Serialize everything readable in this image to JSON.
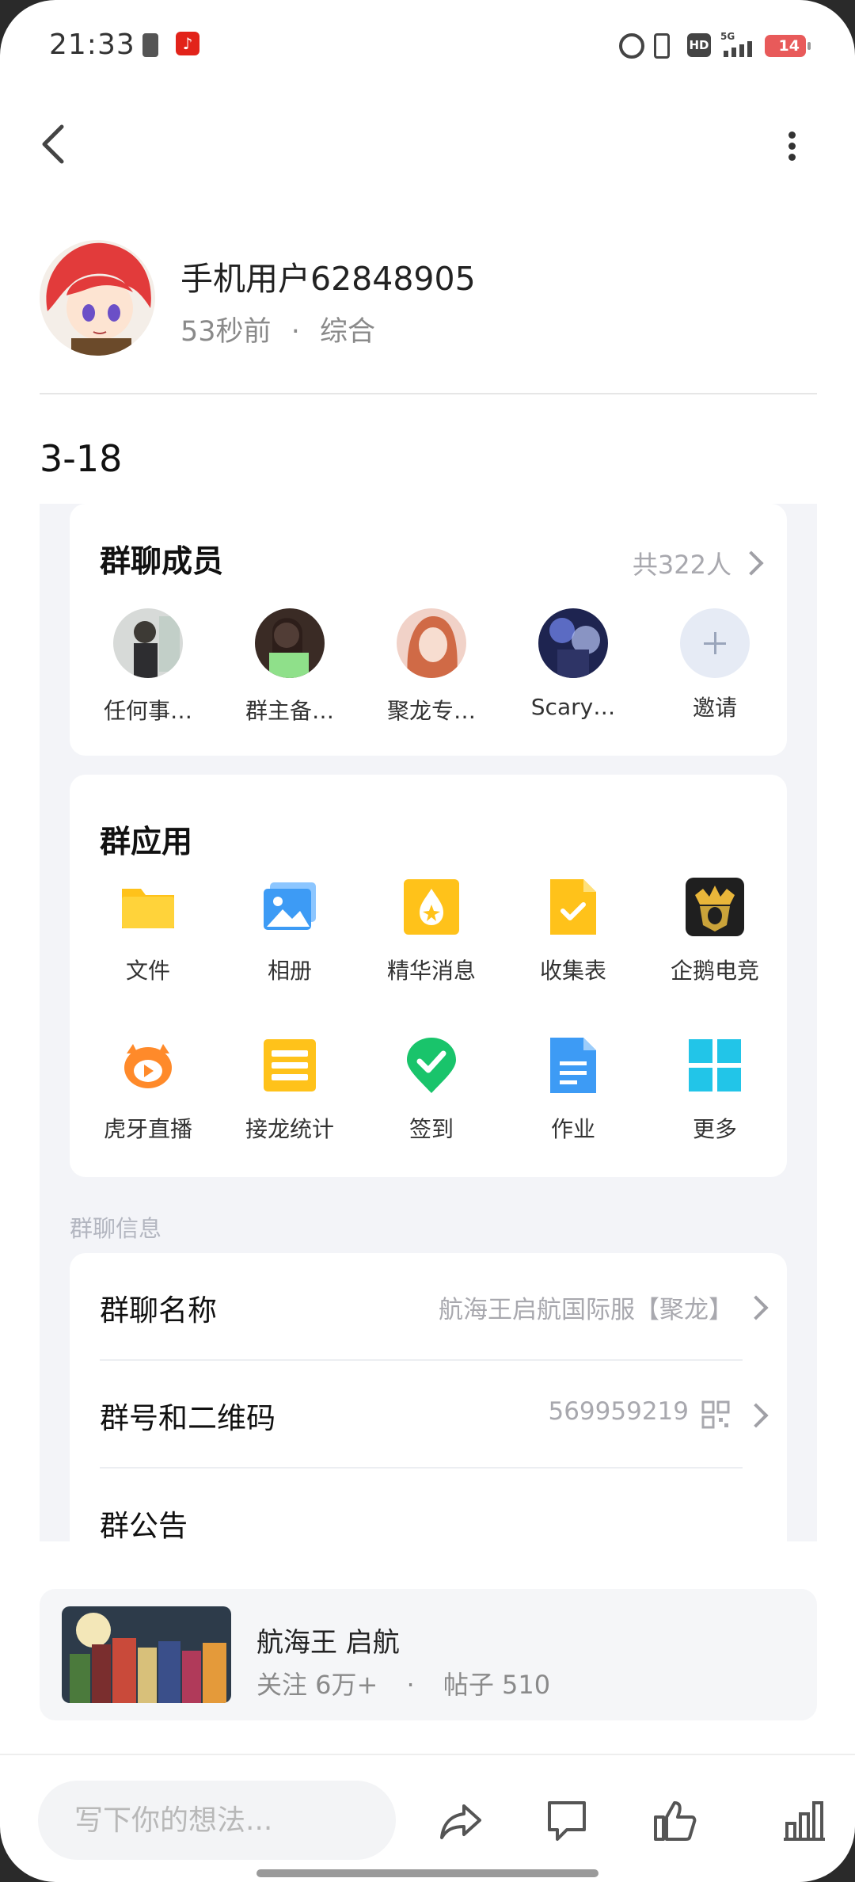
{
  "status_bar": {
    "time": "21:33",
    "battery": "14",
    "network_badge": "HD",
    "network_gen": "5G",
    "app_badge_icon": "netease-music-icon"
  },
  "nav": {
    "back_icon": "chevron-left-icon",
    "more_icon": "more-vertical-icon"
  },
  "author": {
    "name": "手机用户62848905",
    "time_ago": "53秒前",
    "separator": "·",
    "category": "综合"
  },
  "post": {
    "title": "3-18"
  },
  "group_card": {
    "members": {
      "title": "群聊成员",
      "count": "共322人",
      "items": [
        {
          "label": "任何事…"
        },
        {
          "label": "群主备…"
        },
        {
          "label": "聚龙专…"
        },
        {
          "label": "Scary…"
        },
        {
          "label": "邀请"
        }
      ]
    },
    "apps": {
      "title": "群应用",
      "items": [
        {
          "label": "文件",
          "icon": "folder-icon"
        },
        {
          "label": "相册",
          "icon": "photo-album-icon"
        },
        {
          "label": "精华消息",
          "icon": "essence-message-icon"
        },
        {
          "label": "收集表",
          "icon": "collection-form-icon"
        },
        {
          "label": "企鹅电竞",
          "icon": "penguin-esports-icon"
        },
        {
          "label": "虎牙直播",
          "icon": "huya-live-icon"
        },
        {
          "label": "接龙统计",
          "icon": "relay-stats-icon"
        },
        {
          "label": "签到",
          "icon": "check-in-icon"
        },
        {
          "label": "作业",
          "icon": "homework-icon"
        },
        {
          "label": "更多",
          "icon": "more-grid-icon"
        }
      ]
    },
    "info": {
      "section_label": "群聊信息",
      "rows": [
        {
          "key": "群聊名称",
          "value": "航海王启航国际服【聚龙】"
        },
        {
          "key": "群号和二维码",
          "value": "569959219"
        },
        {
          "key": "群公告",
          "value": ""
        }
      ]
    }
  },
  "game": {
    "name": "航海王 启航",
    "followers": "关注 6万+",
    "separator": "·",
    "posts": "帖子 510"
  },
  "bottom_bar": {
    "comment_placeholder": "写下你的想法...",
    "actions": [
      "share-icon",
      "comment-icon",
      "like-icon",
      "stats-icon"
    ]
  },
  "colors": {
    "accent_yellow": "#FFC21A",
    "accent_blue": "#3D9BF5",
    "accent_green": "#19C46B",
    "muted_text": "#8A8A8A"
  }
}
